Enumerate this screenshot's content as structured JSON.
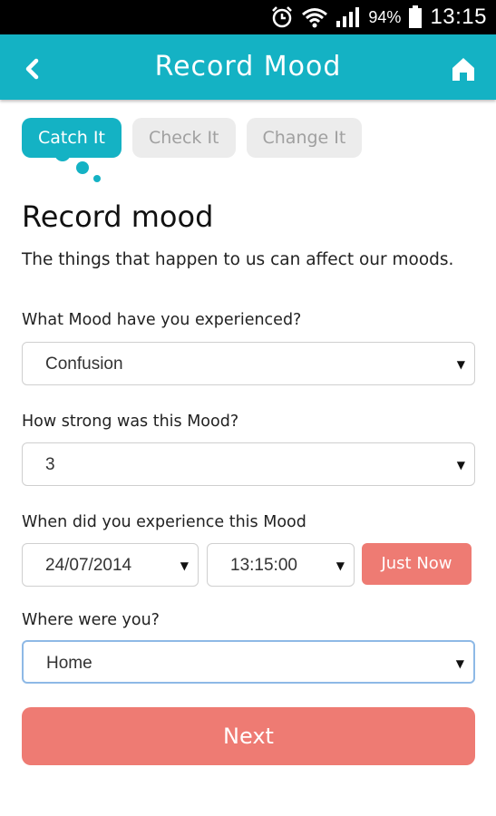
{
  "status_bar": {
    "battery_percent": "94%",
    "time": "13:15",
    "icons": [
      "alarm-icon",
      "wifi-icon",
      "signal-icon",
      "battery-icon"
    ]
  },
  "app_bar": {
    "title": "Record Mood",
    "back_icon": "chevron-left-icon",
    "home_icon": "home-icon",
    "color": "#14b2c4"
  },
  "tabs": [
    {
      "label": "Catch It",
      "active": true
    },
    {
      "label": "Check It",
      "active": false
    },
    {
      "label": "Change It",
      "active": false
    }
  ],
  "page": {
    "heading": "Record mood",
    "intro": "The things that happen to us can affect our moods."
  },
  "form": {
    "mood_label": "What Mood have you experienced?",
    "mood_value": "Confusion",
    "strength_label": "How strong was this Mood?",
    "strength_value": "3",
    "when_label": "When did you experience this Mood",
    "date_value": "24/07/2014",
    "time_value": "13:15:00",
    "just_now_label": "Just Now",
    "where_label": "Where were you?",
    "where_value": "Home",
    "next_label": "Next"
  },
  "colors": {
    "accent": "#14b2c4",
    "button": "#ee7b73",
    "inactive_tab": "#ececec"
  }
}
